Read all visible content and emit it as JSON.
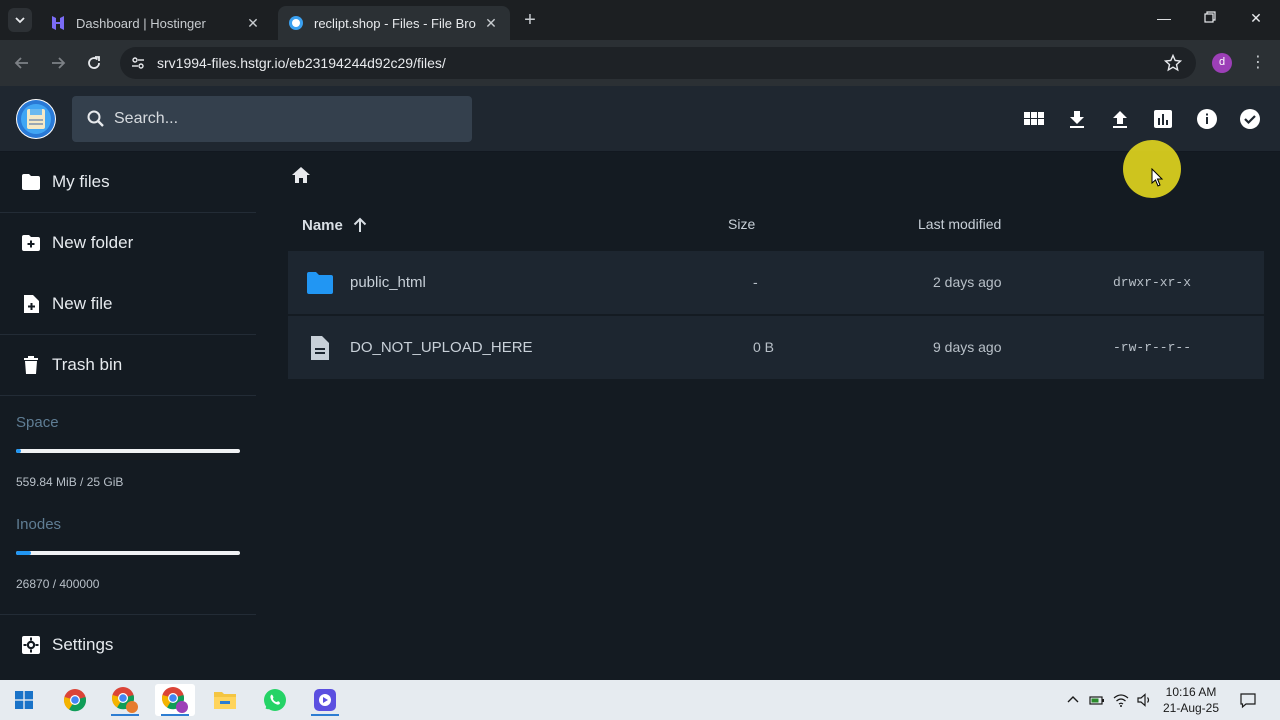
{
  "browser": {
    "tabs": [
      {
        "title": "Dashboard | Hostinger",
        "active": false
      },
      {
        "title": "reclipt.shop - Files - File Browser",
        "active": true
      }
    ],
    "url": "srv1994-files.hstgr.io/eb23194244d92c29/files/",
    "profile_initial": "d"
  },
  "header": {
    "search_placeholder": "Search..."
  },
  "sidebar": {
    "items": [
      {
        "label": "My files",
        "icon": "folder-icon"
      },
      {
        "label": "New folder",
        "icon": "create-new-folder-icon"
      },
      {
        "label": "New file",
        "icon": "note-add-icon"
      },
      {
        "label": "Trash bin",
        "icon": "trash-icon"
      }
    ],
    "space": {
      "title": "Space",
      "usage": "559.84 MiB / 25 GiB",
      "fraction": 0.022
    },
    "inodes": {
      "title": "Inodes",
      "usage": "26870 / 400000",
      "fraction": 0.067
    },
    "settings_label": "Settings"
  },
  "listing": {
    "columns": {
      "name": "Name",
      "size": "Size",
      "modified": "Last modified"
    },
    "rows": [
      {
        "name": "public_html",
        "size": "-",
        "modified": "2 days ago",
        "permissions": "drwxr-xr-x",
        "type": "folder"
      },
      {
        "name": "DO_NOT_UPLOAD_HERE",
        "size": "0 B",
        "modified": "9 days ago",
        "permissions": "-rw-r--r--",
        "type": "file"
      }
    ]
  },
  "taskbar": {
    "time": "10:16 AM",
    "date": "21-Aug-25"
  },
  "colors": {
    "accent": "#2196f3",
    "folder": "#2196f3",
    "background": "#141b22",
    "header": "#1f2730"
  }
}
